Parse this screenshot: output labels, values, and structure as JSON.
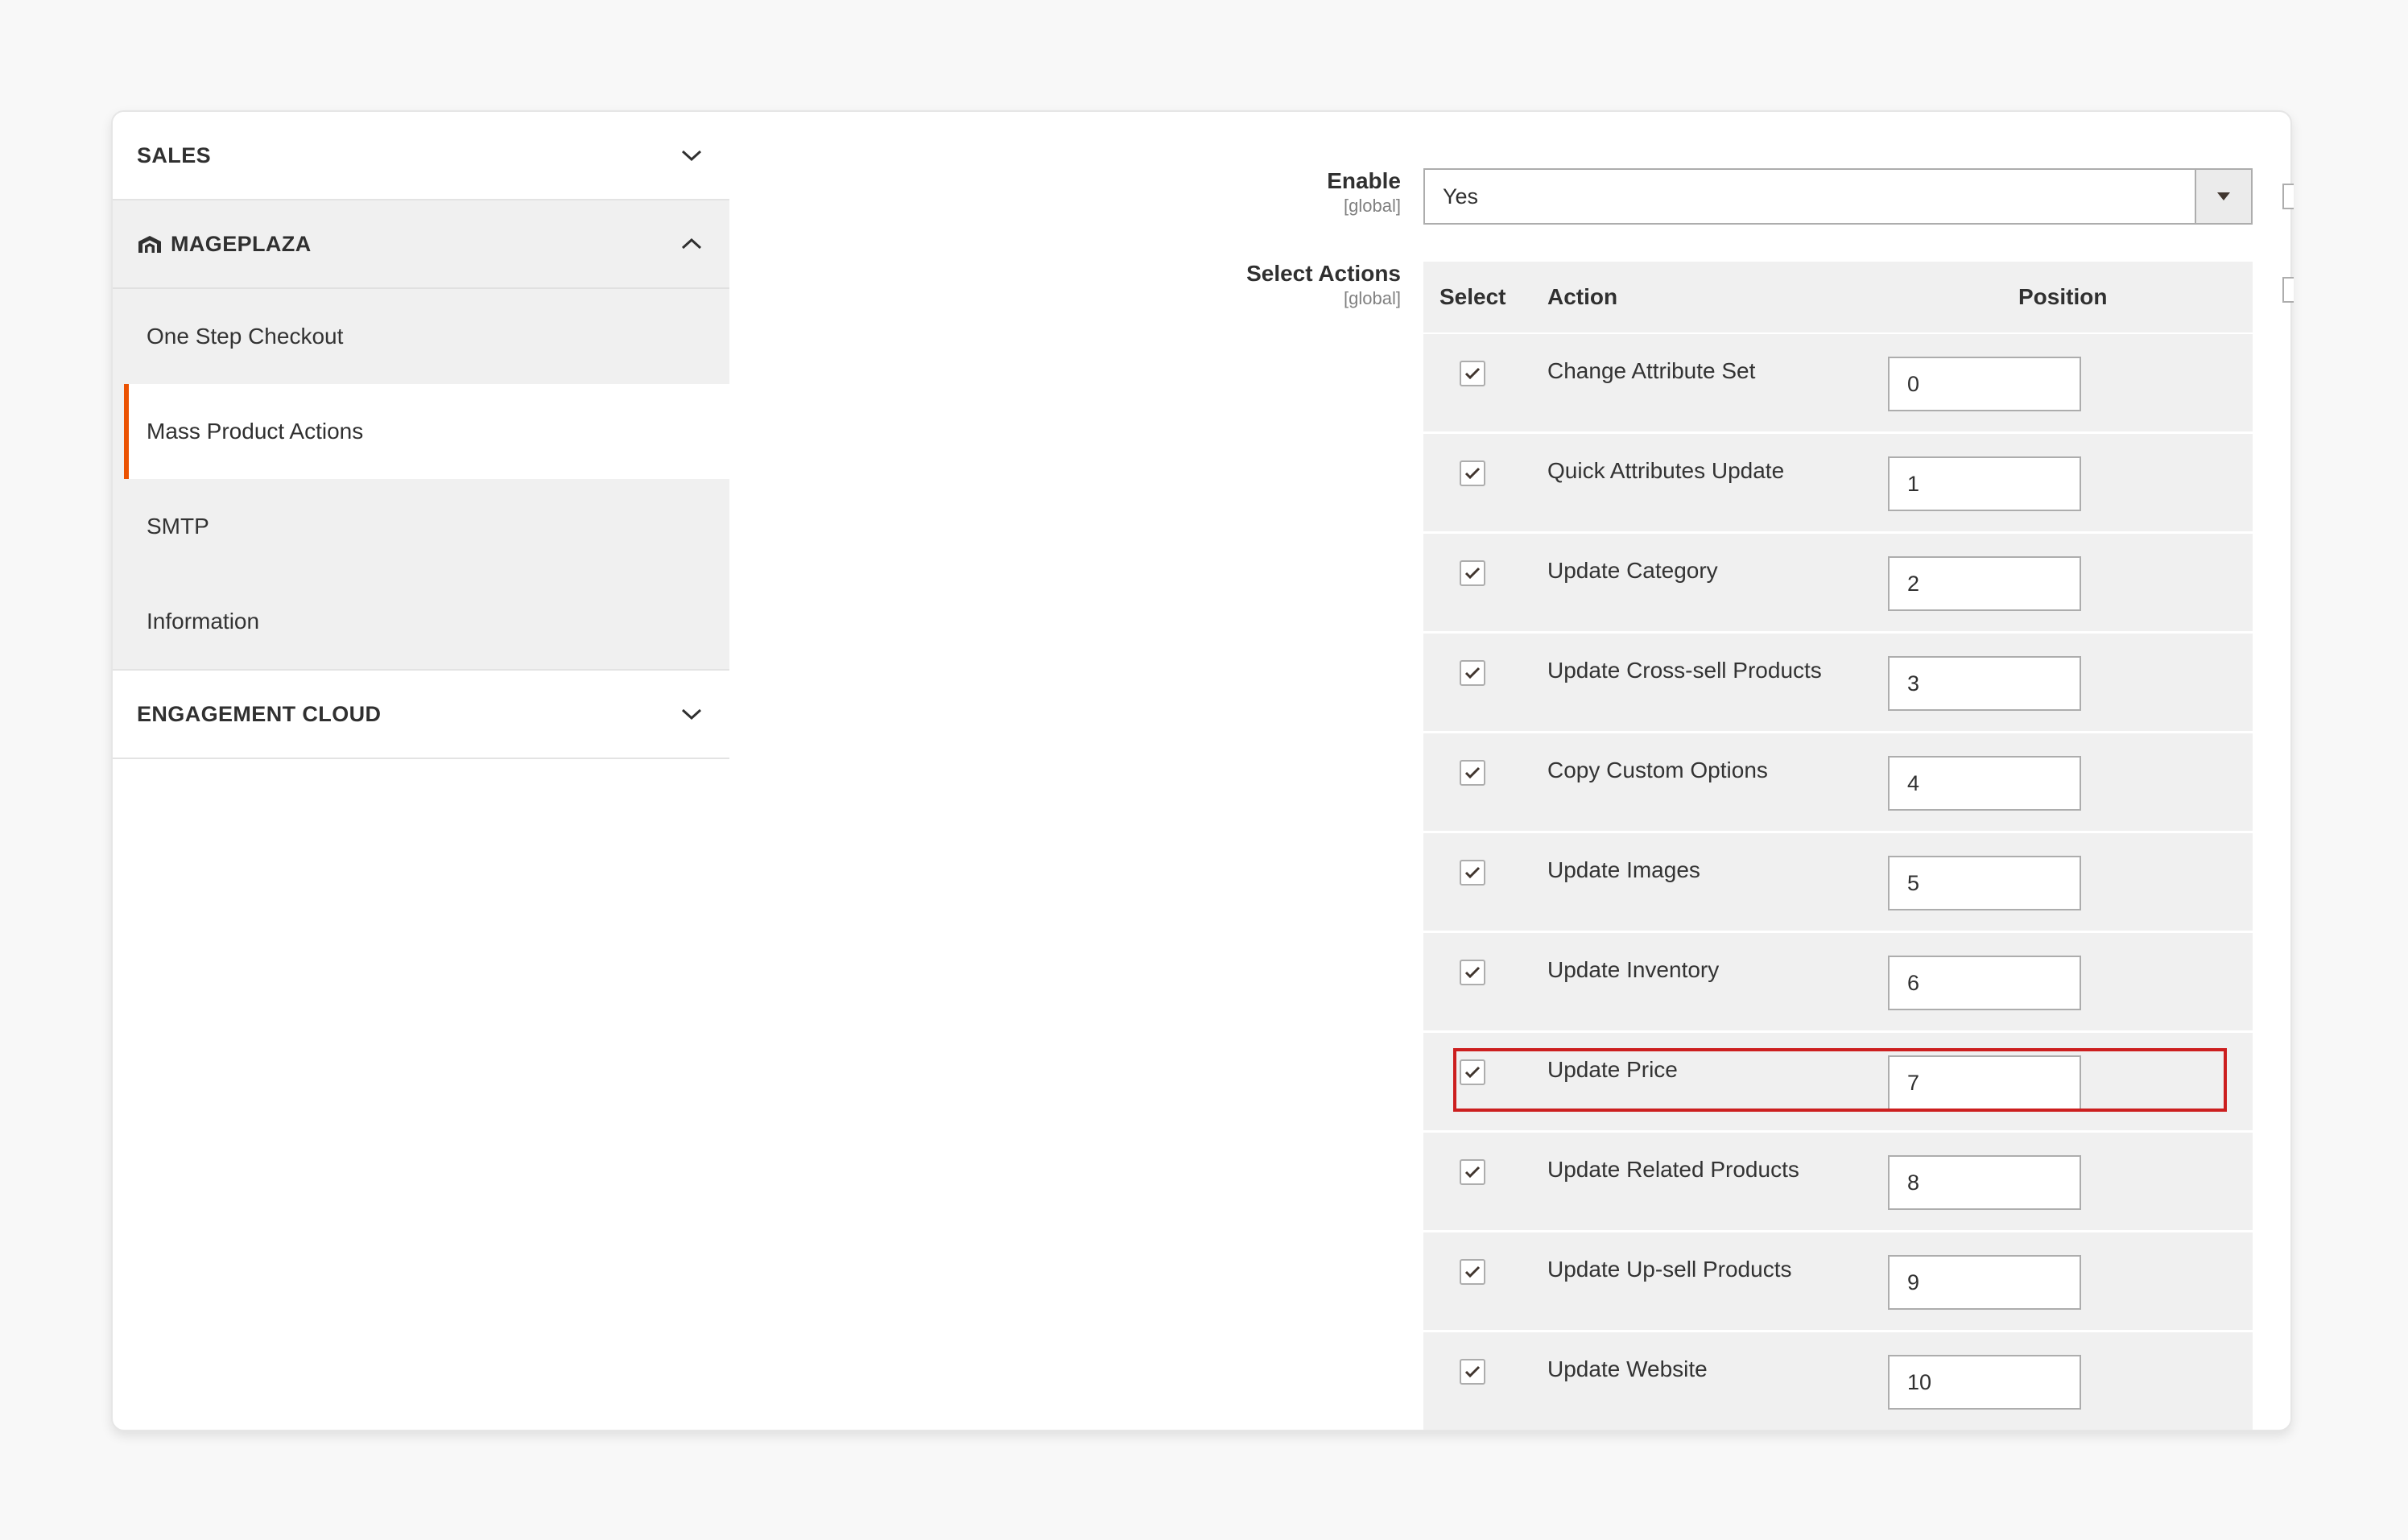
{
  "sidebar": {
    "sections": [
      {
        "title": "SALES",
        "expanded": false
      },
      {
        "title": "MAGEPLAZA",
        "expanded": true
      },
      {
        "title": "ENGAGEMENT CLOUD",
        "expanded": false
      }
    ],
    "mageplaza_items": [
      {
        "label": "One Step Checkout",
        "active": false
      },
      {
        "label": "Mass Product Actions",
        "active": true
      },
      {
        "label": "SMTP",
        "active": false
      },
      {
        "label": "Information",
        "active": false
      }
    ]
  },
  "form": {
    "enable": {
      "label": "Enable",
      "scope": "[global]",
      "value": "Yes"
    },
    "select_actions": {
      "label": "Select Actions",
      "scope": "[global]",
      "columns": [
        "Select",
        "Action",
        "Position"
      ],
      "rows": [
        {
          "checked": true,
          "action": "Change Attribute Set",
          "position": "0"
        },
        {
          "checked": true,
          "action": "Quick Attributes Update",
          "position": "1"
        },
        {
          "checked": true,
          "action": "Update Category",
          "position": "2"
        },
        {
          "checked": true,
          "action": "Update Cross-sell Products",
          "position": "3"
        },
        {
          "checked": true,
          "action": "Copy Custom Options",
          "position": "4"
        },
        {
          "checked": true,
          "action": "Update Images",
          "position": "5"
        },
        {
          "checked": true,
          "action": "Update Inventory",
          "position": "6"
        },
        {
          "checked": true,
          "action": "Update Price",
          "position": "7",
          "highlighted": true
        },
        {
          "checked": true,
          "action": "Update Related Products",
          "position": "8"
        },
        {
          "checked": true,
          "action": "Update Up-sell Products",
          "position": "9"
        },
        {
          "checked": true,
          "action": "Update Website",
          "position": "10"
        }
      ]
    }
  },
  "colors": {
    "active_accent": "#eb5202",
    "highlight": "#cc1f1f"
  },
  "icons": {
    "collapsed": "chevron-down-icon",
    "expanded": "chevron-up-icon",
    "brand": "mageplaza-logo-icon",
    "checkbox": "checkmark-icon",
    "select": "dropdown-arrow-icon"
  }
}
